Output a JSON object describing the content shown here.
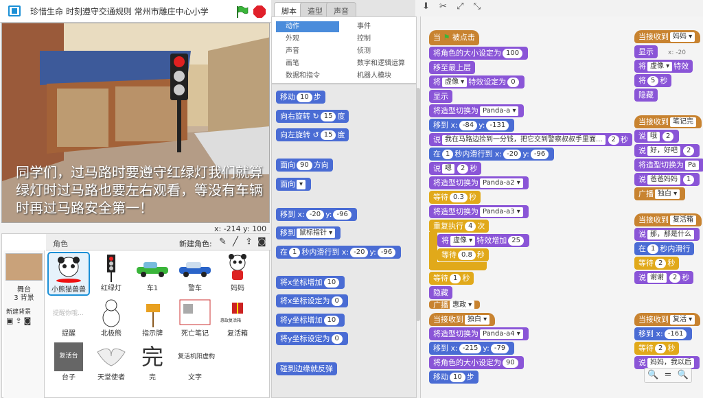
{
  "header": {
    "title": "珍惜生命 时刻遵守交通规则  常州市雕庄中心小学"
  },
  "stage": {
    "caption": "同学们，过马路时要遵守红绿灯我们就算绿灯时过马路也要左右观看，等没有车辆时再过马路安全第一！",
    "coords": "x: -214 y: 100"
  },
  "sprites": {
    "header": "角色",
    "new_sprite": "新建角色:",
    "stage_label": "舞台",
    "backdrops": "3 背景",
    "new_backdrop": "新建背景",
    "items": [
      "小熊猫兽兽",
      "红绿灯",
      "车1",
      "警车",
      "妈妈",
      "提醒",
      "北极熊",
      "指示牌",
      "死亡笔记",
      "复活箱",
      "台子",
      "天堂使者",
      "完",
      "文字"
    ],
    "revive_label": "复活台",
    "wan": "完",
    "wenzi": "复活机阳虚构"
  },
  "tabs": [
    "脚本",
    "造型",
    "声音"
  ],
  "categories": {
    "left": [
      "动作",
      "外观",
      "声音",
      "画笔",
      "数据和指令"
    ],
    "right": [
      "事件",
      "控制",
      "侦测",
      "数字和逻辑运算",
      "机器人模块"
    ]
  },
  "palette": {
    "move": "移动",
    "move_n": "10",
    "step": "步",
    "turn_r": "向右旋转",
    "turn_l": "向左旋转",
    "deg_n": "15",
    "deg": "度",
    "point": "面向",
    "point_n": "90",
    "dir": "方向",
    "face": "面向",
    "goto": "移到",
    "x": "x:",
    "y": "y:",
    "goto_x": "-20",
    "goto_y": "-96",
    "goto_target": "鼠标指针",
    "in": "在",
    "glide_n": "1",
    "glide": "秒内滑行到",
    "cx_add": "将x坐标增加",
    "cx_set": "将x坐标设定为",
    "cy_add": "将y坐标增加",
    "cy_set": "将y坐标设定为",
    "v10": "10",
    "v0": "0",
    "bounce": "碰到边缘就反弹"
  },
  "script1": {
    "hat": "当",
    "hat2": "被点击",
    "size_set": "将角色的大小设定为",
    "size_v": "100",
    "front": "移至最上层",
    "effect": "将",
    "ghost": "虚像",
    "eff_set": "特效设定为",
    "eff_v": "0",
    "show": "显示",
    "costume": "将造型切换为",
    "c1": "Panda-a",
    "goto": "移到",
    "x": "x:",
    "y": "y:",
    "gx": "-84",
    "gy": "-131",
    "say": "说",
    "say_text": "我在马路边捡到一分钱，把它交到警察叔叔手里面...",
    "say_n": "2",
    "sec": "秒",
    "in": "在",
    "glide_n": "1",
    "glide": "秒内滑行到",
    "glx": "-20",
    "gly": "-96",
    "say2": "嗯",
    "say2_n": "2",
    "c2": "Panda-a2",
    "wait": "等待",
    "w1": "0.3",
    "c3": "Panda-a3",
    "repeat": "重复执行",
    "rep_n": "4",
    "times": "次",
    "eff_add": "特效增加",
    "eff_add_v": "25",
    "w2": "0.8",
    "w3": "1",
    "hide": "隐藏",
    "broadcast": "广播",
    "bc_v": "惠政",
    "recv": "当接收到",
    "recv_v": "独白",
    "c4": "Panda-a4",
    "g2x": "-215",
    "g2y": "-79",
    "size_v2": "90",
    "move": "移动",
    "move_n": "10",
    "step": "步"
  },
  "script2": {
    "recv": "当接收到",
    "mama": "妈妈",
    "show": "显示",
    "xcoord": "x: -20",
    "ghost": "虚像",
    "eff": "特效",
    "wait": "等待",
    "w5": "5",
    "sec": "秒",
    "hide": "隐藏",
    "note": "笔记完",
    "say": "说",
    "s1": "哦",
    "n2": "2",
    "s2": "好，好吧",
    "c": "将造型切换为",
    "pa": "Pa",
    "s3": "爸爸妈妈",
    "n1": "1",
    "bc": "广播",
    "bc_v": "独白",
    "revive": "复活箱",
    "s4": "那，那是什么",
    "in": "在",
    "glide": "秒内滑行",
    "thanks": "谢谢",
    "revive2": "复活",
    "gx": "-161",
    "s5": "妈妈，我以后"
  },
  "zoom": {
    "minus": "🔍",
    "eq": "=",
    "plus": "🔍"
  }
}
